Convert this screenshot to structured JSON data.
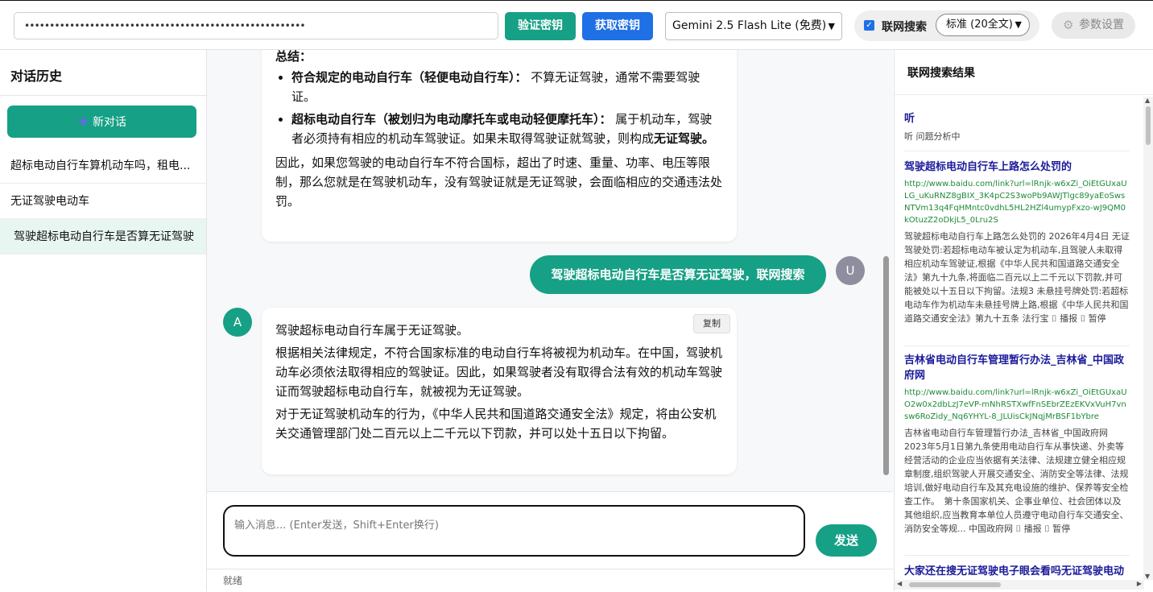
{
  "header": {
    "api_key_masked": "••••••••••••••••••••••••••••••••••••••••••••••••••••••••",
    "verify_label": "验证密钥",
    "get_key_label": "获取密钥",
    "model_selected": "Gemini 2.5 Flash Lite (免费)",
    "web_search_label": "联网搜索",
    "web_search_checked": true,
    "search_mode_selected": "标准 (20全文)",
    "settings_label": "参数设置"
  },
  "sidebar": {
    "title": "对话历史",
    "new_chat_label": "新对话",
    "items": [
      {
        "label": "超标电动自行车算机动车吗，租电..."
      },
      {
        "label": "无证驾驶电动车"
      },
      {
        "label": "驾驶超标电动自行车是否算无证驾驶",
        "active": true
      }
    ]
  },
  "chat": {
    "msg1": {
      "heading": "总结：",
      "bullet1_strong": "符合规定的电动自行车（轻便电动自行车）：",
      "bullet1_text": " 不算无证驾驶，通常不需要驾驶证。",
      "bullet2_strong": "超标电动自行车（被划归为电动摩托车或电动轻便摩托车）：",
      "bullet2_text": " 属于机动车，驾驶者必须持有相应的机动车驾驶证。如果未取得驾驶证就驾驶，则构成",
      "bullet2_end": "无证驾驶。",
      "para": "因此，如果您驾驶的电动自行车不符合国标，超出了时速、重量、功率、电压等限制，那么您就是在驾驶机动车，没有驾驶证就是无证驾驶，会面临相应的交通违法处罚。"
    },
    "user_message": "驾驶超标电动自行车是否算无证驾驶，联网搜索",
    "user_avatar": "U",
    "assistant_avatar": "A",
    "msg2": {
      "copy_label": "复制",
      "p1": "驾驶超标电动自行车属于无证驾驶。",
      "p2": "根据相关法律规定，不符合国家标准的电动自行车将被视为机动车。在中国，驾驶机动车必须依法取得相应的驾驶证。因此，如果驾驶者没有取得合法有效的机动车驾驶证而驾驶超标电动自行车，就被视为无证驾驶。",
      "p3": "对于无证驾驶机动车的行为，《中华人民共和国道路交通安全法》规定，将由公安机关交通管理部门处二百元以上二千元以下罚款，并可以处十五日以下拘留。"
    }
  },
  "input": {
    "placeholder": "输入消息... (Enter发送，Shift+Enter换行)",
    "send_label": "发送"
  },
  "status": "就绪",
  "results_panel": {
    "title": "联网搜索结果",
    "results": [
      {
        "title": "听",
        "url": "",
        "snippet": "听 问题分析中"
      },
      {
        "title": "驾驶超标电动自行车上路怎么处罚的",
        "url": "http://www.baidu.com/link?url=lRnjk-w6xZi_OiEtGUxaULG_uKuRNZ8gBIX_3K4pC2S3woPb9AWJTlgc89yaEoSwsNTVm13q4FqHMntc0vdhL5HL2HZl4umypFxzo-wJ9QM0kOtuzZ2oDkjL5_0Lru2S",
        "snippet": "驾驶超标电动自行车上路怎么处罚的 2026年4月4日 无证驾驶处罚:若超标电动车被认定为机动车,且驾驶人未取得相应机动车驾驶证,根据《中华人民共和国道路交通安全法》第九十九条,将面临二百元以上二千元以下罚款,并可能被处以十五日以下拘留。法规3 未悬挂号牌处罚:若超标电动车作为机动车未悬挂号牌上路,根据《中华人民共和国道路交通安全法》第九十五条 法行宝 ⌷ 播报 ⌷ 暂停"
      },
      {
        "title": "吉林省电动自行车管理暂行办法_吉林省_中国政府网",
        "url": "http://www.baidu.com/link?url=lRnjk-w6xZi_OiEtGUxaUO2w0x2dbLzJ7eVP-mNhRSTXwfFnSEbrZEzEKVxVuH7vnsw6RoZidy_Nq6YHYL-8_JLUisCkJNqjMrBSF1bYbre",
        "snippet": "吉林省电动自行车管理暂行办法_吉林省_中国政府网 2023年5月1日第九条使用电动自行车从事快递、外卖等经营活动的企业应当依据有关法律、法规建立健全相应规章制度,组织驾驶人开展交通安全、消防安全等法律、法规培训,做好电动自行车及其充电设施的维护、保养等安全检查工作。　第十条国家机关、企事业单位、社会团体以及其他组织,应当教育本单位人员遵守电动自行车交通安全、消防安全等规... 中国政府网 ⌷ 播报 ⌷ 暂停"
      },
      {
        "title": "大家还在搜无证驾驶电子眼会看吗无证驾驶电动",
        "url": "",
        "snippet": ""
      }
    ]
  },
  "colors": {
    "accent": "#16a085",
    "primary_blue": "#1f6fe5",
    "result_title": "#1a1a9a",
    "result_url": "#1e8a3a"
  }
}
